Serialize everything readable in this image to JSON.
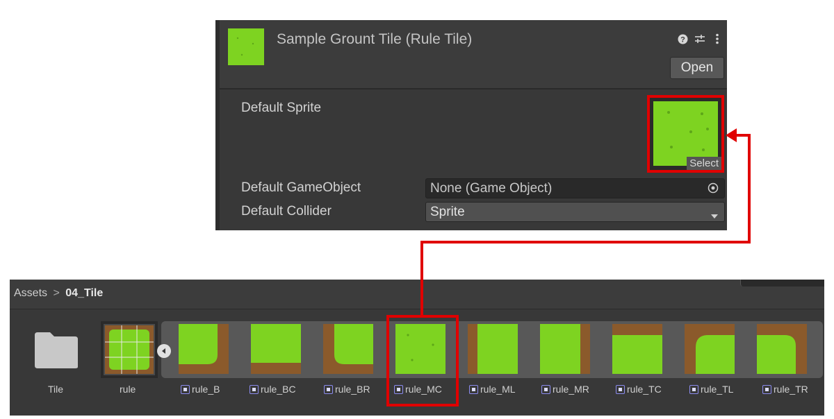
{
  "inspector": {
    "title": "Sample Grount Tile (Rule Tile)",
    "open_button": "Open",
    "icons": [
      "help-icon",
      "preset-sliders-icon",
      "kebab-menu-icon"
    ],
    "fields": {
      "default_sprite_label": "Default Sprite",
      "select_label": "Select",
      "default_gameobject_label": "Default GameObject",
      "default_gameobject_value": "None (Game Object)",
      "default_collider_label": "Default Collider",
      "default_collider_value": "Sprite"
    }
  },
  "project_browser": {
    "breadcrumb_root": "Assets",
    "breadcrumb_separator": ">",
    "breadcrumb_current": "04_Tile",
    "assets": [
      {
        "label": "Tile",
        "kind": "folder"
      },
      {
        "label": "rule",
        "kind": "rule-tile"
      },
      {
        "label": "rule_B",
        "kind": "sprite",
        "highlighted": false
      },
      {
        "label": "rule_BC",
        "kind": "sprite",
        "highlighted": false
      },
      {
        "label": "rule_BR",
        "kind": "sprite",
        "highlighted": false
      },
      {
        "label": "rule_MC",
        "kind": "sprite",
        "highlighted": true
      },
      {
        "label": "rule_ML",
        "kind": "sprite",
        "highlighted": false
      },
      {
        "label": "rule_MR",
        "kind": "sprite",
        "highlighted": false
      },
      {
        "label": "rule_TC",
        "kind": "sprite",
        "highlighted": false
      },
      {
        "label": "rule_TL",
        "kind": "sprite",
        "highlighted": false
      },
      {
        "label": "rule_TR",
        "kind": "sprite",
        "highlighted": false
      }
    ]
  },
  "colors": {
    "highlight": "#e00000",
    "grass": "#7ed321",
    "dirt": "#8b5a2b",
    "panel": "#383838"
  }
}
